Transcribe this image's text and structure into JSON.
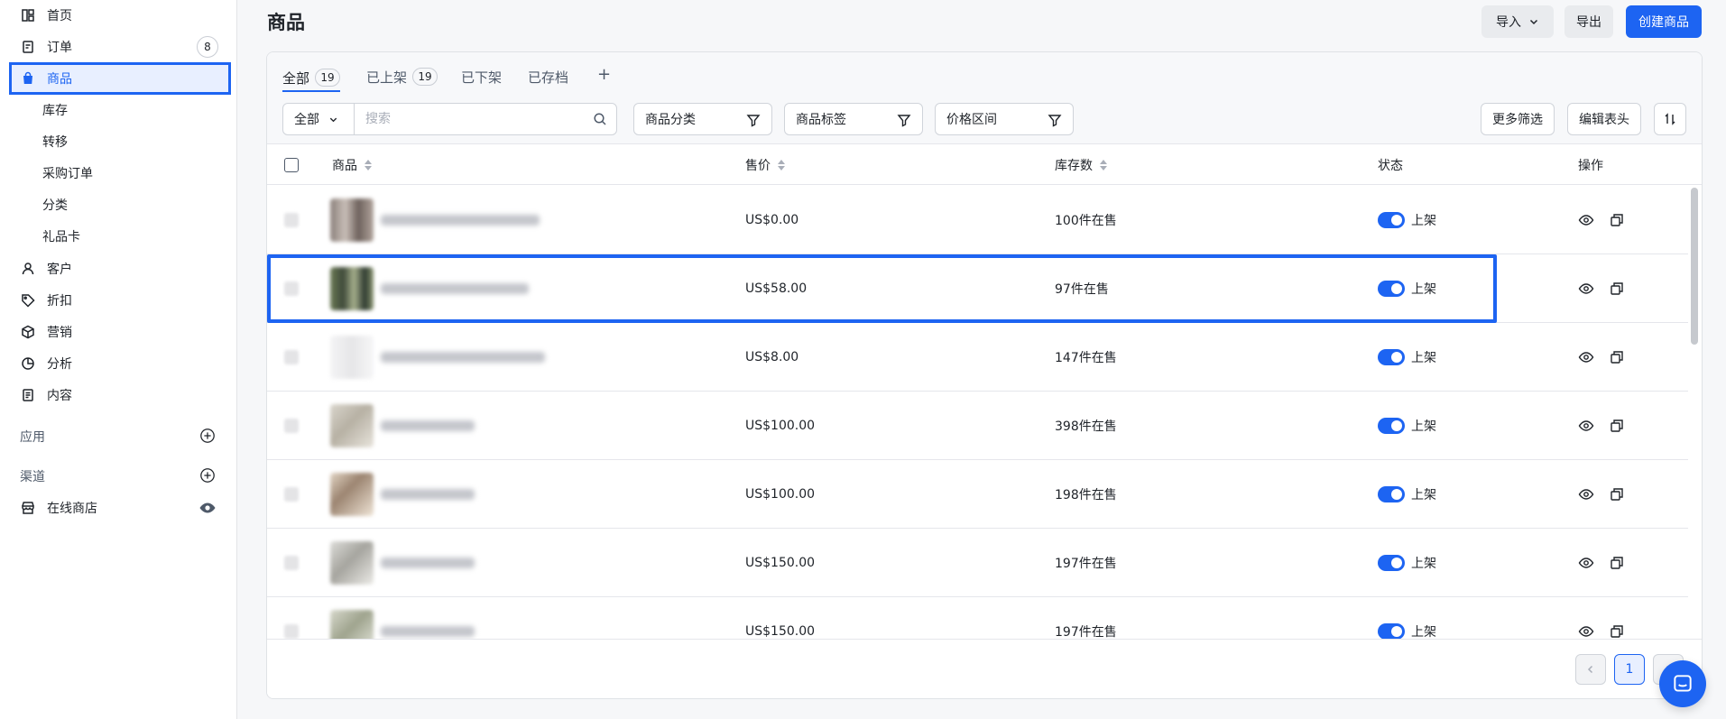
{
  "sidebar": {
    "items": [
      {
        "label": "首页",
        "icon": "home-grid-icon"
      },
      {
        "label": "订单",
        "icon": "order-icon",
        "badge": "8"
      },
      {
        "label": "商品",
        "icon": "bag-icon"
      },
      {
        "label": "客户",
        "icon": "user-icon"
      },
      {
        "label": "折扣",
        "icon": "tag-icon"
      },
      {
        "label": "营销",
        "icon": "cube-icon"
      },
      {
        "label": "分析",
        "icon": "pie-icon"
      },
      {
        "label": "内容",
        "icon": "document-icon"
      }
    ],
    "sub_items": [
      "库存",
      "转移",
      "采购订单",
      "分类",
      "礼品卡"
    ],
    "apps_label": "应用",
    "channels_label": "渠道",
    "online_store_label": "在线商店"
  },
  "header": {
    "title": "商品",
    "import_label": "导入",
    "export_label": "导出",
    "create_label": "创建商品"
  },
  "tabs": [
    {
      "label": "全部",
      "count": "19"
    },
    {
      "label": "已上架",
      "count": "19"
    },
    {
      "label": "已下架"
    },
    {
      "label": "已存档"
    }
  ],
  "tab_add": "+",
  "filters": {
    "scope": "全部",
    "search_placeholder": "搜索",
    "category": "商品分类",
    "tags": "商品标签",
    "price_range": "价格区间",
    "more_filters": "更多筛选",
    "edit_columns": "编辑表头"
  },
  "columns": {
    "product": "商品",
    "price": "售价",
    "stock": "库存数",
    "status": "状态",
    "actions": "操作"
  },
  "rows": [
    {
      "price": "US$0.00",
      "stock": "100件在售",
      "status": "上架"
    },
    {
      "price": "US$58.00",
      "stock": "97件在售",
      "status": "上架"
    },
    {
      "price": "US$8.00",
      "stock": "147件在售",
      "status": "上架"
    },
    {
      "price": "US$100.00",
      "stock": "398件在售",
      "status": "上架"
    },
    {
      "price": "US$100.00",
      "stock": "198件在售",
      "status": "上架"
    },
    {
      "price": "US$150.00",
      "stock": "197件在售",
      "status": "上架"
    },
    {
      "price": "US$150.00",
      "stock": "197件在售",
      "status": "上架"
    }
  ],
  "pagination": {
    "current_page": "1"
  },
  "colors": {
    "accent": "#1d64f2",
    "highlight_bg": "#e8efff"
  }
}
